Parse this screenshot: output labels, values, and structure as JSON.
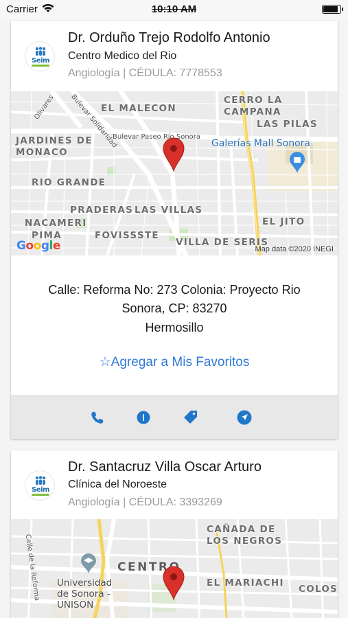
{
  "status_bar": {
    "carrier": "Carrier",
    "time": "10:10 AM"
  },
  "colors": {
    "accent": "#1f77c9",
    "link": "#2f7bd6",
    "pin": "#d8312a",
    "action_bar": "#e8e8e8"
  },
  "cards": [
    {
      "logo_text": "Seim",
      "name": "Dr. Orduño Trejo Rodolfo Antonio",
      "clinic": "Centro Medico del Rio",
      "specialty": "Angiología | CÉDULA: 7778553",
      "map": {
        "labels": {
          "el_malecon": "EL MALECON",
          "cerro_la_campana": "CERRO LA\nCAMPANA",
          "las_pilas": "LAS PILAS",
          "jardines": "JARDINES DE\nMONACO",
          "galerias": "Galerías Mall Sonora",
          "rio_grande": "RIO GRANDE",
          "praderas": "PRADERAS",
          "las_villas": "LAS VILLAS",
          "nacameri": "NACAMERI",
          "pima": "PIMA",
          "fovissste": "FOVISSSTE",
          "villa_de_seris": "VILLA DE SERIS",
          "el_jito": "EL JITO",
          "olivares": "Olivares",
          "solidaridad": "Bulevar Solidaridad",
          "paseo_rio": "Bulevar Paseo Río Sonora"
        },
        "credit": "Map data ©2020 INEGI",
        "google": [
          "G",
          "o",
          "o",
          "g",
          "l",
          "e"
        ]
      },
      "address": "Calle: Reforma No: 273 Colonia: Proyecto Rio Sonora, CP: 83270",
      "city": "Hermosillo",
      "favorite_label": "☆Agregar a Mis Favoritos",
      "actions": [
        "phone-icon",
        "clock-icon",
        "tag-icon",
        "navigation-icon"
      ]
    },
    {
      "logo_text": "Seim",
      "name": "Dr. Santacruz Villa Oscar Arturo",
      "clinic": "Clínica del Noroeste",
      "specialty": "Angiología | CÉDULA: 3393269",
      "map": {
        "labels": {
          "canada": "CAÑADA DE\nLOS NEGROS",
          "centro": "CENTRO",
          "el_mariachi": "EL MARIACHI",
          "colos": "COLOS",
          "unison": "Universidad\nde Sonora -\nUNISON",
          "reforma": "Calle de la Reforma"
        }
      }
    }
  ]
}
